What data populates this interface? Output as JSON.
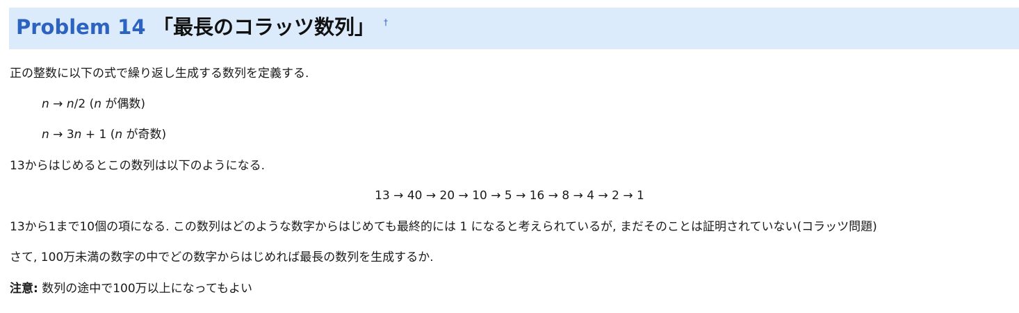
{
  "header": {
    "problem_number": "Problem 14",
    "title": "「最長のコラッツ数列」",
    "dagger": "†"
  },
  "body": {
    "intro": "正の整数に以下の式で繰り返し生成する数列を定義する.",
    "rule_even": {
      "var1": "n",
      "arrow": " → ",
      "var2": "n",
      "expr": "/2 (",
      "var3": "n",
      "cond": " が偶数)"
    },
    "rule_odd": {
      "var1": "n",
      "arrow": " → 3",
      "var2": "n",
      "expr": " + 1 (",
      "var3": "n",
      "cond": " が奇数)"
    },
    "example_intro": "13からはじめるとこの数列は以下のようになる.",
    "sequence": "13 → 40 → 20 → 10 → 5 → 16 → 8 → 4 → 2 → 1",
    "explanation": "13から1まで10個の項になる. この数列はどのような数字からはじめても最終的には 1 になると考えられているが, まだそのことは証明されていない(コラッツ問題)",
    "question": "さて, 100万未満の数字の中でどの数字からはじめれば最長の数列を生成するか.",
    "note_label": "注意:",
    "note_text": " 数列の途中で100万以上になってもよい"
  },
  "colors": {
    "header_bg": "#dcebfb",
    "problem_number": "#2c62c0",
    "text": "#1a1a1a"
  }
}
